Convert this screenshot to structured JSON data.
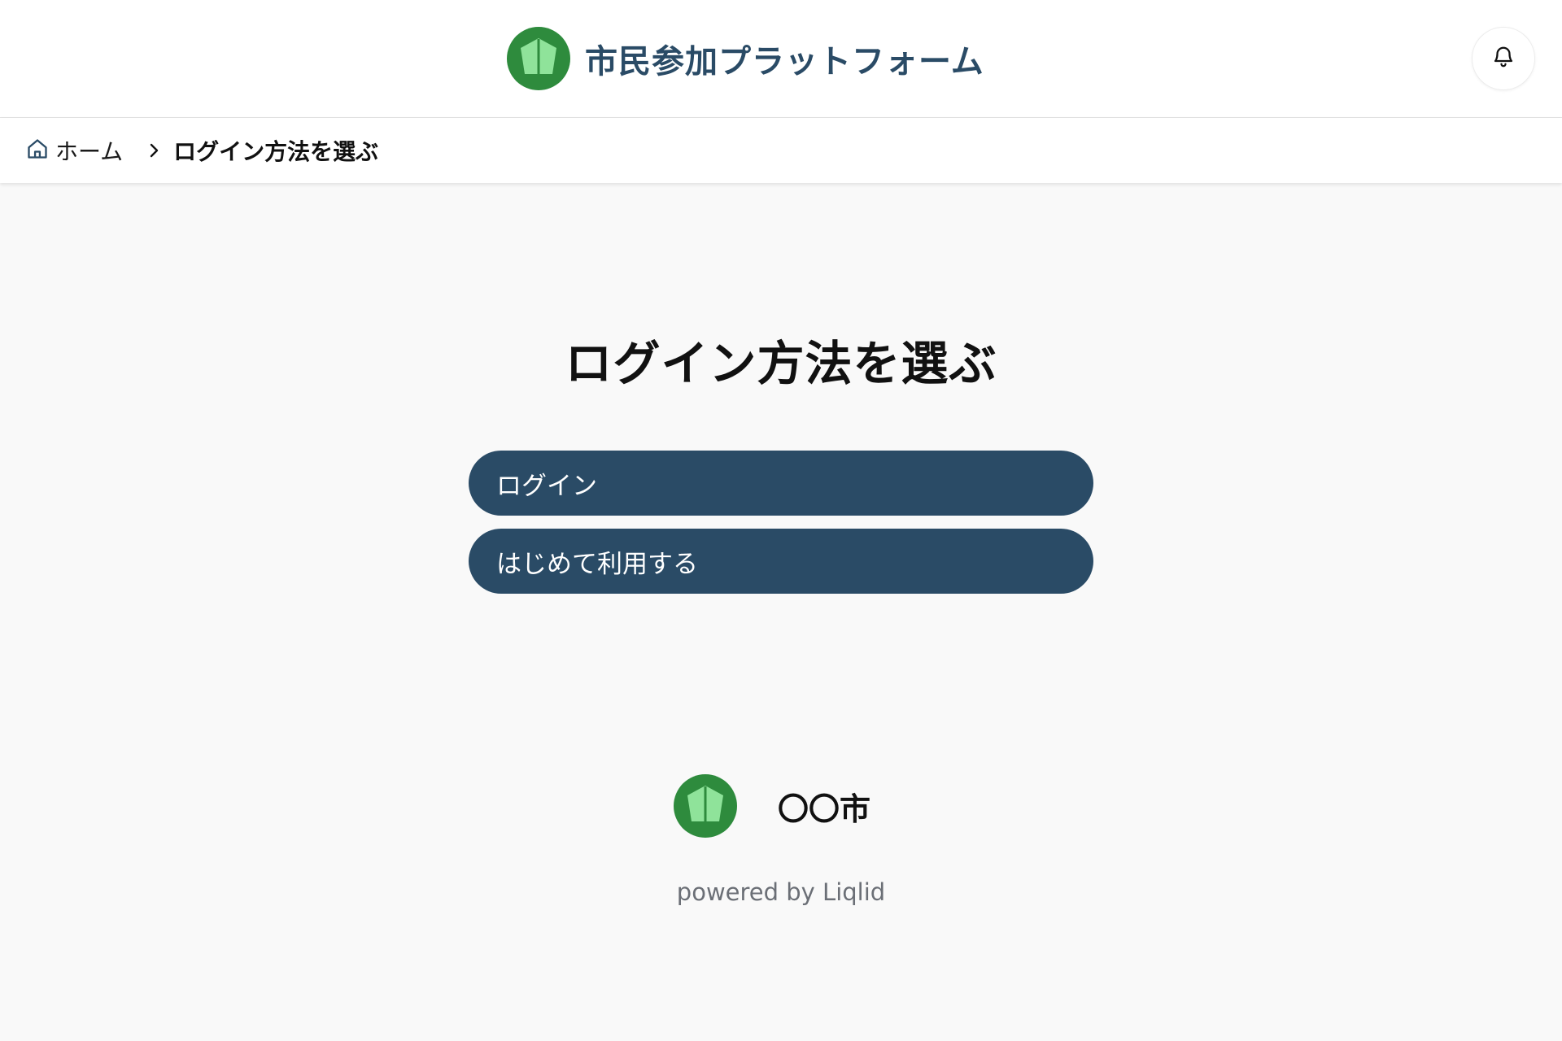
{
  "header": {
    "title": "市民参加プラットフォーム",
    "logo_icon": "leaf-pentagon-logo-icon",
    "notification_icon": "bell-icon"
  },
  "breadcrumb": {
    "home_icon": "home-icon",
    "home_label": "ホーム",
    "separator_icon": "chevron-right-icon",
    "current_label": "ログイン方法を選ぶ"
  },
  "main": {
    "title": "ログイン方法を選ぶ",
    "buttons": [
      {
        "label": "ログイン"
      },
      {
        "label": "はじめて利用する"
      }
    ]
  },
  "footer": {
    "city_name": "〇〇市",
    "powered_by": "powered by Liqlid"
  },
  "colors": {
    "primary": "#2a4b66",
    "logo_green_dark": "#2e8b3d",
    "logo_green_light": "#8fe39a",
    "background": "#f9f9f9"
  }
}
